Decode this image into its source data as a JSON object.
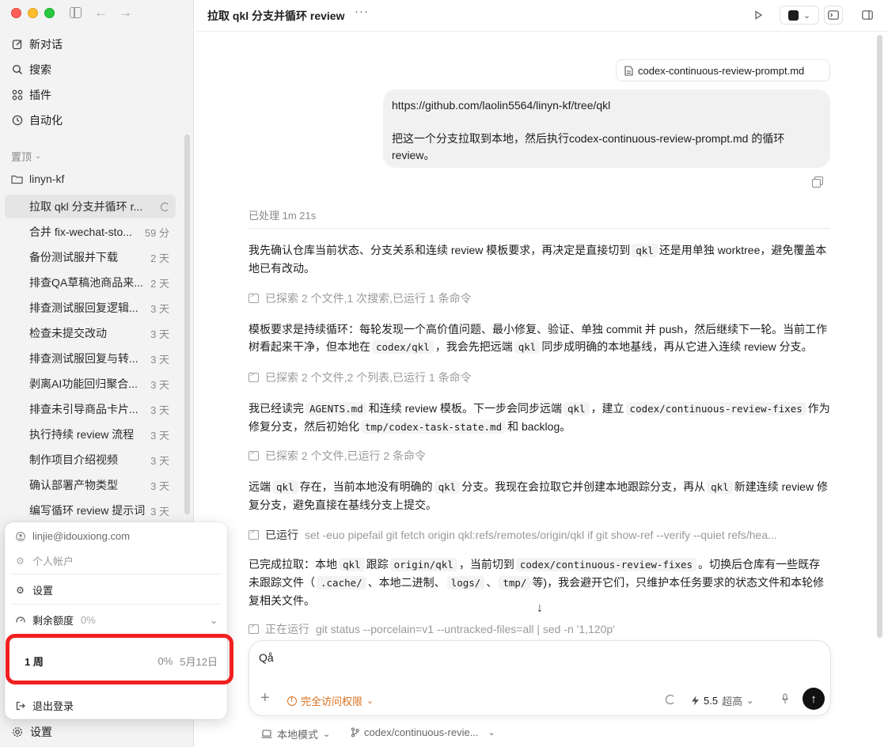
{
  "sidebar": {
    "nav": [
      {
        "label": "新对话",
        "icon": "compose-icon"
      },
      {
        "label": "搜索",
        "icon": "search-icon"
      },
      {
        "label": "插件",
        "icon": "plugins-icon"
      },
      {
        "label": "自动化",
        "icon": "clock-icon"
      }
    ],
    "pinned_label": "置顶",
    "project": "linyn-kf",
    "threads": [
      {
        "title": "拉取 qkl 分支并循环 r...",
        "time": ""
      },
      {
        "title": "合并 fix-wechat-sto...",
        "time": "59 分"
      },
      {
        "title": "备份测试服并下载",
        "time": "2 天"
      },
      {
        "title": "排查QA草稿池商品来...",
        "time": "2 天"
      },
      {
        "title": "排查测试服回复逻辑...",
        "time": "3 天"
      },
      {
        "title": "检查未提交改动",
        "time": "3 天"
      },
      {
        "title": "排查测试服回复与转...",
        "time": "3 天"
      },
      {
        "title": "剥离AI功能回归聚合...",
        "time": "3 天"
      },
      {
        "title": "排查未引导商品卡片...",
        "time": "3 天"
      },
      {
        "title": "执行持续 review 流程",
        "time": "3 天"
      },
      {
        "title": "制作项目介绍视频",
        "time": "3 天"
      },
      {
        "title": "确认部署产物类型",
        "time": "3 天"
      },
      {
        "title": "编写循环 review 提示词",
        "time": "3 天"
      }
    ],
    "bottom_settings": "设置"
  },
  "account_menu": {
    "email": "linjie@idouxiong.com",
    "personal_account": "个人帐户",
    "settings": "设置",
    "quota_label": "剩余额度",
    "quota_value": "0%",
    "week_label": "1 周",
    "week_percent": "0%",
    "week_date": "5月12日",
    "logout": "退出登录"
  },
  "header": {
    "title": "拉取 qkl 分支并循环 review",
    "more": "···"
  },
  "conversation": {
    "attached_file": "codex-continuous-review-prompt.md",
    "user_line1": "https://github.com/laolin5564/linyn-kf/tree/qkl",
    "user_line2": "把这一个分支拉取到本地，然后执行codex-continuous-review-prompt.md 的循环review。",
    "processed": "已处理 1m 21s",
    "p1_a": "我先确认仓库当前状态、分支关系和连续 review 模板要求，再决定是直接切到",
    "p1_code1": "qkl",
    "p1_b": "还是用单独 worktree，避免覆盖本地已有改动。",
    "step1": "已探索 2 个文件,1 次搜索,已运行 1 条命令",
    "p2_a": "模板要求是持续循环：每轮发现一个高价值问题、最小修复、验证、单独 commit 并 push，然后继续下一轮。当前工作树看起来干净，但本地在",
    "p2_code1": "codex/qkl",
    "p2_b": "，我会先把远端",
    "p2_code2": "qkl",
    "p2_c": "同步成明确的本地基线，再从它进入连续 review 分支。",
    "step2": "已探索 2 个文件,2 个列表,已运行 1 条命令",
    "p3_a": "我已经读完",
    "p3_code1": "AGENTS.md",
    "p3_b": "和连续 review 模板。下一步会同步远端",
    "p3_code2": "qkl",
    "p3_c": "，建立",
    "p3_code3": "codex/continuous-review-fixes",
    "p3_d": "作为修复分支，然后初始化",
    "p3_code4": "tmp/codex-task-state.md",
    "p3_e": "和 backlog。",
    "step3": "已探索 2 个文件,已运行 2 条命令",
    "p4_a": "远端",
    "p4_code1": "qkl",
    "p4_b": "存在，当前本地没有明确的",
    "p4_code2": "qkl",
    "p4_c": "分支。我现在会拉取它并创建本地跟踪分支，再从",
    "p4_code3": "qkl",
    "p4_d": "新建连续 review 修复分支，避免直接在基线分支上提交。",
    "step4_prefix": "已运行",
    "step4_cmd": "set -euo pipefail git fetch origin qkl:refs/remotes/origin/qkl if git show-ref --verify --quiet refs/hea...",
    "p5_a": "已完成拉取：本地",
    "p5_code1": "qkl",
    "p5_b": "跟踪",
    "p5_code2": "origin/qkl",
    "p5_c": "，当前切到",
    "p5_code3": "codex/continuous-review-fixes",
    "p5_d": "。切换后仓库有一些既存未跟踪文件（",
    "p5_code4": ".cache/",
    "p5_e": "、本地二进制、",
    "p5_code5": "logs/",
    "p5_f": "、",
    "p5_code6": "tmp/",
    "p5_g": "等)，我会避开它们，只维护本任务要求的状态文件和本轮修复相关文件。",
    "step5_prefix": "正在运行",
    "step5_cmd": "git status --porcelain=v1 --untracked-files=all | sed -n '1,120p'"
  },
  "composer": {
    "input_value": "Qå",
    "permission": "完全访问权限",
    "model_version": "5.5",
    "model_level": "超高"
  },
  "footer": {
    "mode": "本地模式",
    "branch": "codex/continuous-revie..."
  },
  "colors": {
    "accent_orange": "#d9701e",
    "highlight_red": "#f02020"
  }
}
